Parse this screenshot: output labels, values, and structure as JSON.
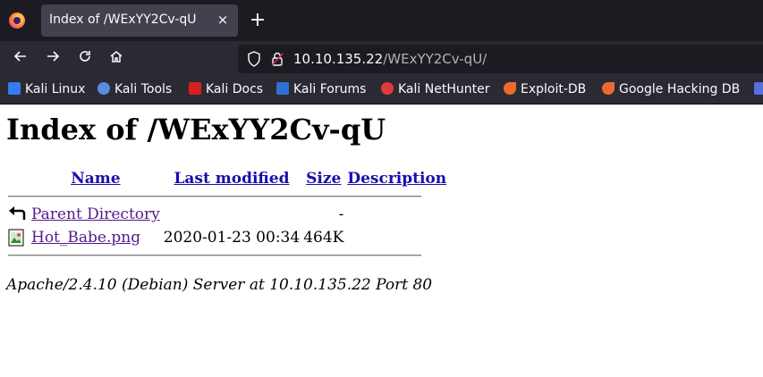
{
  "browser": {
    "tab_title": "Index of /WExYY2Cv-qU",
    "tab_close": "×",
    "new_tab": "+",
    "url_host": "10.10.135.22",
    "url_path": "/WExYY2Cv-qU/",
    "bookmarks": [
      {
        "label": "Kali Linux",
        "icon": "kali-dragon-icon",
        "color": "#367bf0"
      },
      {
        "label": "Kali Tools",
        "icon": "kali-tools-icon",
        "color": "#5a8be0"
      },
      {
        "label": "Kali Docs",
        "icon": "kali-docs-icon",
        "color": "#d61f1f"
      },
      {
        "label": "Kali Forums",
        "icon": "kali-forums-icon",
        "color": "#2f6fd6"
      },
      {
        "label": "Kali NetHunter",
        "icon": "kali-nethunter-icon",
        "color": "#e03a3a"
      },
      {
        "label": "Exploit-DB",
        "icon": "exploit-db-icon",
        "color": "#ec6a2e"
      },
      {
        "label": "Google Hacking DB",
        "icon": "ghdb-icon",
        "color": "#ec6a2e"
      }
    ]
  },
  "page": {
    "heading": "Index of /WExYY2Cv-qU",
    "columns": {
      "name": "Name",
      "last_modified": "Last modified",
      "size": "Size",
      "description": "Description"
    },
    "rows": [
      {
        "icon": "parent-directory-icon",
        "name": "Parent Directory",
        "modified": "",
        "size": "-",
        "description": ""
      },
      {
        "icon": "image-file-icon",
        "name": "Hot_Babe.png",
        "modified": "2020-01-23 00:34",
        "size": "464K",
        "description": ""
      }
    ],
    "footer": "Apache/2.4.10 (Debian) Server at 10.10.135.22 Port 80"
  }
}
